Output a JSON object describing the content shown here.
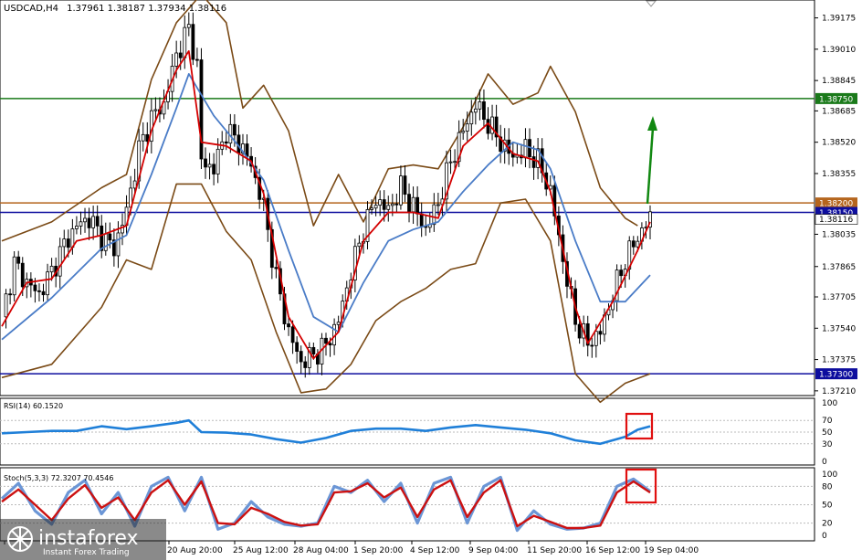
{
  "header": {
    "title": "USDCAD,H4",
    "ohlc": "1.37961 1.38187 1.37934 1.38116"
  },
  "colors": {
    "candle": "#000000",
    "ma_fast": "#d40000",
    "ma_slow": "#4a7cc7",
    "bands": "#7a4a16",
    "level_green": "#1a7a1a",
    "level_blue": "#0d0d9e",
    "level_brown": "#b5651d",
    "arrow": "#118811",
    "rsi_line": "#1f7fd8",
    "stoch_main": "#6b96d6",
    "stoch_signal": "#cc1111",
    "highlight": "#e01010"
  },
  "chart_data": [
    {
      "type": "candlestick",
      "symbol": "USDCAD",
      "timeframe": "H4",
      "y_axis_ticks": [
        "1.39175",
        "1.39010",
        "1.38845",
        "1.38685",
        "1.38520",
        "1.38355",
        "1.38035",
        "1.37865",
        "1.37705",
        "1.37540",
        "1.37375",
        "1.37210"
      ],
      "ylim": [
        1.3719,
        1.3925
      ],
      "x_axis_ticks": [
        "",
        "20 Aug 20:00",
        "25 Aug 12:00",
        "28 Aug 04:00",
        "1 Sep 20:00",
        "4 Sep 12:00",
        "9 Sep 04:00",
        "11 Sep 20:00",
        "16 Sep 12:00",
        "19 Sep 04:00"
      ],
      "price_levels": [
        {
          "label": "1.38750",
          "value": 1.3875,
          "color": "#1a7a1a"
        },
        {
          "label": "1.38200",
          "value": 1.382,
          "color": "#b5651d"
        },
        {
          "label": "1.38150",
          "value": 1.3815,
          "color": "#0d0d9e"
        },
        {
          "label": "1.37300",
          "value": 1.373,
          "color": "#0d0d9e"
        }
      ],
      "current_price": {
        "label": "1.38116",
        "value": 1.38116
      },
      "close_path": [
        [
          0,
          1.376
        ],
        [
          3,
          1.3788
        ],
        [
          6,
          1.3778
        ],
        [
          9,
          1.3772
        ],
        [
          12,
          1.3784
        ],
        [
          15,
          1.3798
        ],
        [
          18,
          1.3808
        ],
        [
          21,
          1.3812
        ],
        [
          24,
          1.3802
        ],
        [
          27,
          1.3796
        ],
        [
          30,
          1.3816
        ],
        [
          33,
          1.3848
        ],
        [
          36,
          1.3865
        ],
        [
          39,
          1.3872
        ],
        [
          42,
          1.3898
        ],
        [
          45,
          1.3912
        ],
        [
          47,
          1.3892
        ],
        [
          48,
          1.3842
        ],
        [
          51,
          1.3838
        ],
        [
          54,
          1.3858
        ],
        [
          57,
          1.3852
        ],
        [
          60,
          1.384
        ],
        [
          63,
          1.3818
        ],
        [
          66,
          1.378
        ],
        [
          69,
          1.3752
        ],
        [
          72,
          1.3736
        ],
        [
          75,
          1.374
        ],
        [
          78,
          1.3745
        ],
        [
          81,
          1.3758
        ],
        [
          84,
          1.3784
        ],
        [
          87,
          1.3806
        ],
        [
          90,
          1.3822
        ],
        [
          93,
          1.3816
        ],
        [
          96,
          1.3828
        ],
        [
          99,
          1.3818
        ],
        [
          102,
          1.3806
        ],
        [
          105,
          1.382
        ],
        [
          108,
          1.3842
        ],
        [
          111,
          1.3858
        ],
        [
          114,
          1.3872
        ],
        [
          117,
          1.3862
        ],
        [
          120,
          1.3852
        ],
        [
          123,
          1.3844
        ],
        [
          126,
          1.3848
        ],
        [
          129,
          1.3842
        ],
        [
          132,
          1.3826
        ],
        [
          135,
          1.379
        ],
        [
          138,
          1.3758
        ],
        [
          141,
          1.3746
        ],
        [
          144,
          1.3752
        ],
        [
          147,
          1.3772
        ],
        [
          150,
          1.379
        ],
        [
          153,
          1.3802
        ],
        [
          156,
          1.3812
        ]
      ],
      "fast_ma_path": [
        [
          0,
          1.3755
        ],
        [
          6,
          1.3778
        ],
        [
          12,
          1.378
        ],
        [
          18,
          1.38
        ],
        [
          24,
          1.3803
        ],
        [
          30,
          1.3808
        ],
        [
          36,
          1.3858
        ],
        [
          42,
          1.389
        ],
        [
          45,
          1.39
        ],
        [
          48,
          1.3852
        ],
        [
          54,
          1.385
        ],
        [
          60,
          1.3842
        ],
        [
          63,
          1.3825
        ],
        [
          69,
          1.376
        ],
        [
          75,
          1.3738
        ],
        [
          81,
          1.3752
        ],
        [
          87,
          1.38
        ],
        [
          93,
          1.3815
        ],
        [
          99,
          1.3815
        ],
        [
          105,
          1.3812
        ],
        [
          111,
          1.385
        ],
        [
          117,
          1.3862
        ],
        [
          123,
          1.3846
        ],
        [
          129,
          1.3842
        ],
        [
          132,
          1.3826
        ],
        [
          138,
          1.3765
        ],
        [
          141,
          1.3746
        ],
        [
          147,
          1.3768
        ],
        [
          153,
          1.3795
        ],
        [
          156,
          1.381
        ]
      ],
      "slow_ma_path": [
        [
          0,
          1.3748
        ],
        [
          12,
          1.377
        ],
        [
          24,
          1.3796
        ],
        [
          30,
          1.3803
        ],
        [
          36,
          1.3835
        ],
        [
          42,
          1.387
        ],
        [
          45,
          1.3888
        ],
        [
          51,
          1.3866
        ],
        [
          57,
          1.385
        ],
        [
          63,
          1.3832
        ],
        [
          69,
          1.3795
        ],
        [
          75,
          1.376
        ],
        [
          81,
          1.3752
        ],
        [
          87,
          1.3778
        ],
        [
          93,
          1.38
        ],
        [
          99,
          1.3806
        ],
        [
          105,
          1.381
        ],
        [
          111,
          1.3826
        ],
        [
          117,
          1.384
        ],
        [
          123,
          1.3852
        ],
        [
          129,
          1.3848
        ],
        [
          132,
          1.3838
        ],
        [
          138,
          1.38
        ],
        [
          144,
          1.3768
        ],
        [
          150,
          1.3768
        ],
        [
          156,
          1.3782
        ]
      ],
      "upper_band_path": [
        [
          0,
          1.38
        ],
        [
          12,
          1.381
        ],
        [
          24,
          1.3828
        ],
        [
          30,
          1.3835
        ],
        [
          36,
          1.3885
        ],
        [
          42,
          1.3915
        ],
        [
          48,
          1.393
        ],
        [
          54,
          1.3915
        ],
        [
          58,
          1.387
        ],
        [
          63,
          1.3882
        ],
        [
          69,
          1.3858
        ],
        [
          75,
          1.3808
        ],
        [
          81,
          1.3835
        ],
        [
          87,
          1.381
        ],
        [
          93,
          1.3838
        ],
        [
          99,
          1.384
        ],
        [
          105,
          1.3838
        ],
        [
          111,
          1.386
        ],
        [
          117,
          1.3888
        ],
        [
          123,
          1.3872
        ],
        [
          129,
          1.3878
        ],
        [
          132,
          1.3892
        ],
        [
          138,
          1.3868
        ],
        [
          144,
          1.3828
        ],
        [
          150,
          1.3812
        ],
        [
          153,
          1.3808
        ]
      ],
      "lower_band_path": [
        [
          0,
          1.3728
        ],
        [
          12,
          1.3735
        ],
        [
          24,
          1.3765
        ],
        [
          30,
          1.379
        ],
        [
          36,
          1.3785
        ],
        [
          42,
          1.383
        ],
        [
          48,
          1.383
        ],
        [
          54,
          1.3805
        ],
        [
          60,
          1.379
        ],
        [
          66,
          1.3752
        ],
        [
          72,
          1.372
        ],
        [
          78,
          1.3722
        ],
        [
          84,
          1.3735
        ],
        [
          90,
          1.3758
        ],
        [
          96,
          1.3768
        ],
        [
          102,
          1.3775
        ],
        [
          108,
          1.3785
        ],
        [
          114,
          1.3788
        ],
        [
          120,
          1.382
        ],
        [
          126,
          1.3822
        ],
        [
          132,
          1.38
        ],
        [
          138,
          1.373
        ],
        [
          144,
          1.3715
        ],
        [
          150,
          1.3725
        ],
        [
          156,
          1.373
        ]
      ]
    },
    {
      "type": "line",
      "indicator": "RSI(14)",
      "label": "RSI(14) 60.1520",
      "value": 60.152,
      "ylim": [
        0,
        100
      ],
      "ticks": [
        "100",
        "70",
        "50",
        "30",
        "0"
      ],
      "path": [
        [
          0,
          48
        ],
        [
          6,
          50
        ],
        [
          12,
          52
        ],
        [
          18,
          52
        ],
        [
          24,
          60
        ],
        [
          30,
          55
        ],
        [
          36,
          60
        ],
        [
          42,
          66
        ],
        [
          45,
          70
        ],
        [
          48,
          50
        ],
        [
          54,
          49
        ],
        [
          60,
          46
        ],
        [
          66,
          38
        ],
        [
          72,
          32
        ],
        [
          78,
          40
        ],
        [
          84,
          52
        ],
        [
          90,
          56
        ],
        [
          96,
          56
        ],
        [
          102,
          52
        ],
        [
          108,
          58
        ],
        [
          114,
          62
        ],
        [
          120,
          58
        ],
        [
          126,
          54
        ],
        [
          132,
          48
        ],
        [
          138,
          36
        ],
        [
          144,
          30
        ],
        [
          150,
          42
        ],
        [
          153,
          54
        ],
        [
          156,
          60
        ]
      ]
    },
    {
      "type": "line",
      "indicator": "Stoch(5,3,3)",
      "label": "Stoch(5,3,3) 72.3207 70.4546",
      "values": [
        72.3207,
        70.4546
      ],
      "ylim": [
        0,
        100
      ],
      "ticks": [
        "100",
        "80",
        "50",
        "20",
        "0"
      ],
      "main_path": [
        [
          0,
          60
        ],
        [
          4,
          85
        ],
        [
          8,
          40
        ],
        [
          12,
          18
        ],
        [
          16,
          70
        ],
        [
          20,
          90
        ],
        [
          24,
          35
        ],
        [
          28,
          70
        ],
        [
          32,
          15
        ],
        [
          36,
          80
        ],
        [
          40,
          95
        ],
        [
          44,
          40
        ],
        [
          48,
          95
        ],
        [
          52,
          10
        ],
        [
          56,
          20
        ],
        [
          60,
          55
        ],
        [
          64,
          30
        ],
        [
          68,
          18
        ],
        [
          72,
          15
        ],
        [
          76,
          20
        ],
        [
          80,
          80
        ],
        [
          84,
          70
        ],
        [
          88,
          90
        ],
        [
          92,
          55
        ],
        [
          96,
          85
        ],
        [
          100,
          20
        ],
        [
          104,
          85
        ],
        [
          108,
          95
        ],
        [
          112,
          20
        ],
        [
          116,
          80
        ],
        [
          120,
          95
        ],
        [
          124,
          8
        ],
        [
          128,
          40
        ],
        [
          132,
          18
        ],
        [
          136,
          10
        ],
        [
          140,
          12
        ],
        [
          144,
          20
        ],
        [
          148,
          80
        ],
        [
          152,
          92
        ],
        [
          156,
          72
        ]
      ],
      "signal_path": [
        [
          0,
          55
        ],
        [
          4,
          75
        ],
        [
          8,
          50
        ],
        [
          12,
          25
        ],
        [
          16,
          60
        ],
        [
          20,
          82
        ],
        [
          24,
          45
        ],
        [
          28,
          62
        ],
        [
          32,
          25
        ],
        [
          36,
          70
        ],
        [
          40,
          90
        ],
        [
          44,
          50
        ],
        [
          48,
          88
        ],
        [
          52,
          20
        ],
        [
          56,
          18
        ],
        [
          60,
          45
        ],
        [
          64,
          35
        ],
        [
          68,
          22
        ],
        [
          72,
          16
        ],
        [
          76,
          18
        ],
        [
          80,
          70
        ],
        [
          84,
          72
        ],
        [
          88,
          85
        ],
        [
          92,
          62
        ],
        [
          96,
          78
        ],
        [
          100,
          30
        ],
        [
          104,
          75
        ],
        [
          108,
          90
        ],
        [
          112,
          30
        ],
        [
          116,
          70
        ],
        [
          120,
          90
        ],
        [
          124,
          15
        ],
        [
          128,
          32
        ],
        [
          132,
          22
        ],
        [
          136,
          12
        ],
        [
          140,
          12
        ],
        [
          144,
          16
        ],
        [
          148,
          70
        ],
        [
          152,
          88
        ],
        [
          156,
          70
        ]
      ]
    }
  ],
  "watermark": {
    "brand": "instaforex",
    "tagline": "Instant Forex Trading"
  }
}
